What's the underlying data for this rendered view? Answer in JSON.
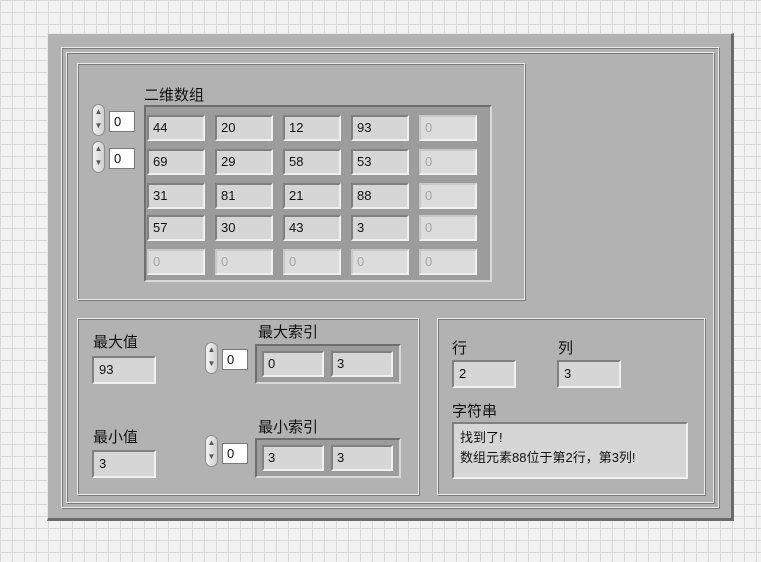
{
  "array2d": {
    "label": "二维数组",
    "row_index": "0",
    "col_index": "0",
    "rows": [
      [
        "44",
        "20",
        "12",
        "93",
        "0"
      ],
      [
        "69",
        "29",
        "58",
        "53",
        "0"
      ],
      [
        "31",
        "81",
        "21",
        "88",
        "0"
      ],
      [
        "57",
        "30",
        "43",
        "3",
        "0"
      ],
      [
        "0",
        "0",
        "0",
        "0",
        "0"
      ]
    ]
  },
  "max": {
    "value_label": "最大值",
    "value": "93",
    "index_label": "最大索引",
    "index_ctrl": "0",
    "index_values": [
      "0",
      "3"
    ]
  },
  "min": {
    "value_label": "最小值",
    "value": "3",
    "index_label": "最小索引",
    "index_ctrl": "0",
    "index_values": [
      "3",
      "3"
    ]
  },
  "result": {
    "row_label": "行",
    "row_value": "2",
    "col_label": "列",
    "col_value": "3",
    "string_label": "字符串",
    "string_lines": [
      "找到了!",
      "数组元素88位于第2行，第3列!"
    ]
  },
  "colors": {
    "panel": "#b2b2b2",
    "indicator": "#d6d6d6",
    "grid_background": "#f2f2f2"
  },
  "icons": {
    "spinner": "increment-decrement-arrows"
  }
}
